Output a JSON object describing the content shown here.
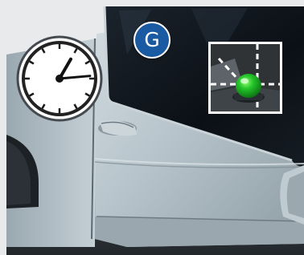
{
  "badge": {
    "letter": "G",
    "color": "#1a5aa3"
  },
  "clock": {
    "icon": "analog-clock-icon",
    "hour_hand_angle_deg": 30,
    "minute_hand_angle_deg": 85
  },
  "indicator": {
    "icon": "green-warning-light-icon",
    "light_color": "#16a516"
  },
  "scene": {
    "subject": "silver car door",
    "window_color": "#0d1218",
    "body_color": "#b9c6cd"
  }
}
